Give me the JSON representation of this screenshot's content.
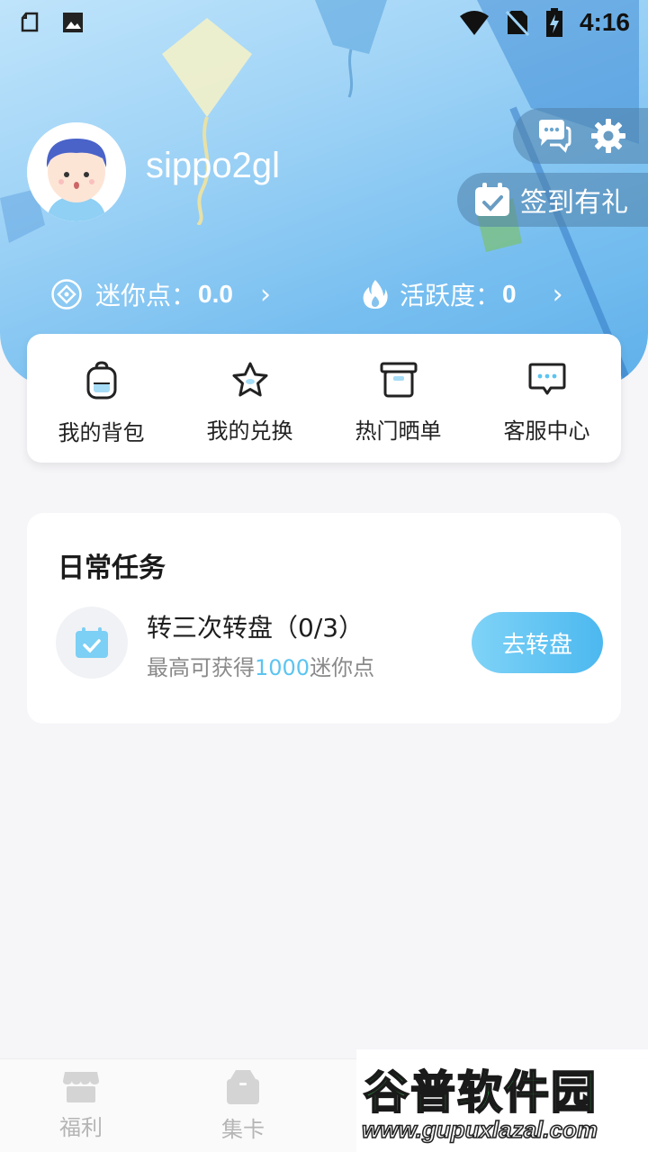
{
  "status_bar": {
    "time": "4:16"
  },
  "profile": {
    "username": "sippo2gl"
  },
  "header_actions": {
    "sign_in_label": "签到有礼"
  },
  "stats": [
    {
      "label": "迷你点：",
      "value": "0.0"
    },
    {
      "label": "活跃度：",
      "value": "0"
    }
  ],
  "quick_menu": [
    {
      "label": "我的背包",
      "icon": "backpack-icon"
    },
    {
      "label": "我的兑换",
      "icon": "star-icon"
    },
    {
      "label": "热门晒单",
      "icon": "box-icon"
    },
    {
      "label": "客服中心",
      "icon": "chat-bubble-icon"
    }
  ],
  "daily_tasks": {
    "title": "日常任务",
    "task": {
      "name": "转三次转盘（0/3）",
      "desc_prefix": "最高可获得",
      "desc_highlight": "1000",
      "desc_suffix": "迷你点",
      "button": "去转盘"
    }
  },
  "bottom_nav": [
    {
      "label": "福利",
      "icon": "shop-icon"
    },
    {
      "label": "集卡",
      "icon": "card-bag-icon"
    }
  ],
  "watermark": {
    "title": "谷普软件园",
    "url": "www.gupuxlazal.com"
  },
  "colors": {
    "accent": "#4cb8ef",
    "highlight": "#5cc4f0",
    "hero": "#78bff0"
  }
}
